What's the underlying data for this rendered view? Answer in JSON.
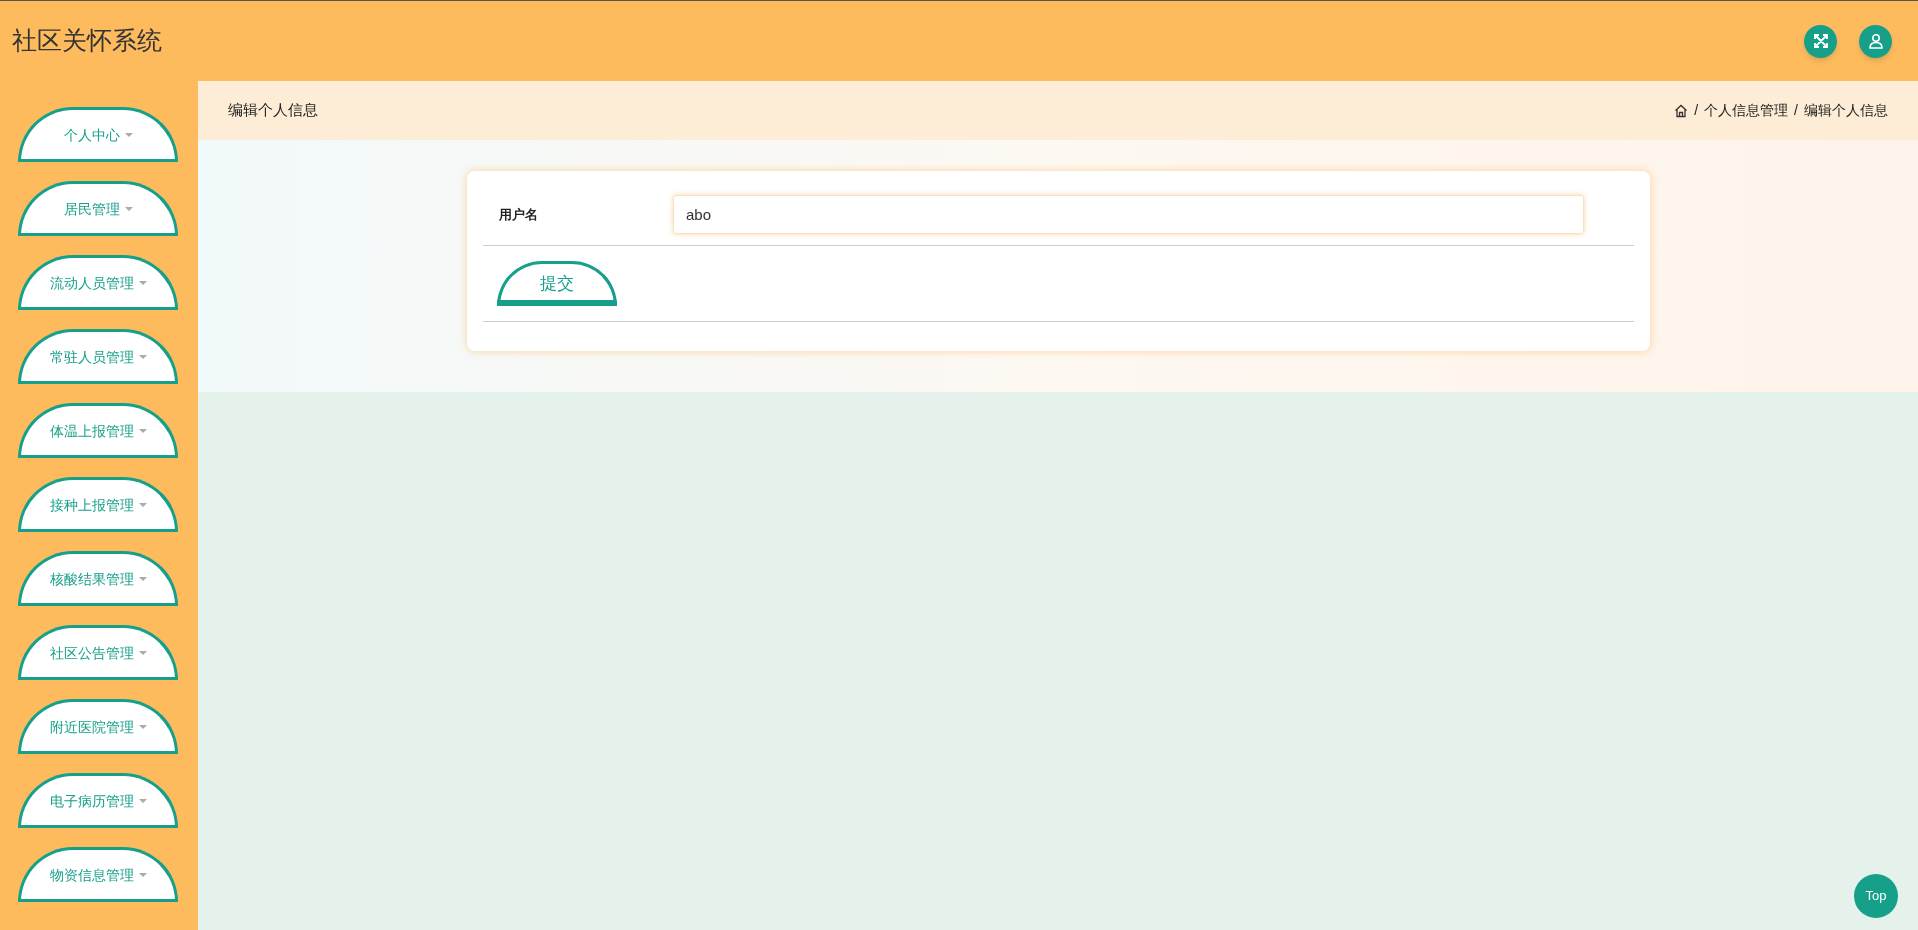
{
  "header": {
    "title": "社区关怀系统"
  },
  "sidebar": {
    "items": [
      {
        "label": "个人中心"
      },
      {
        "label": "居民管理"
      },
      {
        "label": "流动人员管理"
      },
      {
        "label": "常驻人员管理"
      },
      {
        "label": "体温上报管理"
      },
      {
        "label": "接种上报管理"
      },
      {
        "label": "核酸结果管理"
      },
      {
        "label": "社区公告管理"
      },
      {
        "label": "附近医院管理"
      },
      {
        "label": "电子病历管理"
      },
      {
        "label": "物资信息管理"
      }
    ]
  },
  "page_header": {
    "title": "编辑个人信息",
    "breadcrumb": [
      {
        "separator": "/",
        "label": "个人信息管理"
      },
      {
        "separator": "/",
        "label": "编辑个人信息"
      }
    ]
  },
  "form": {
    "fields": [
      {
        "label": "用户名",
        "value": "abo"
      }
    ],
    "submit": "提交"
  },
  "back_to_top": "Top"
}
